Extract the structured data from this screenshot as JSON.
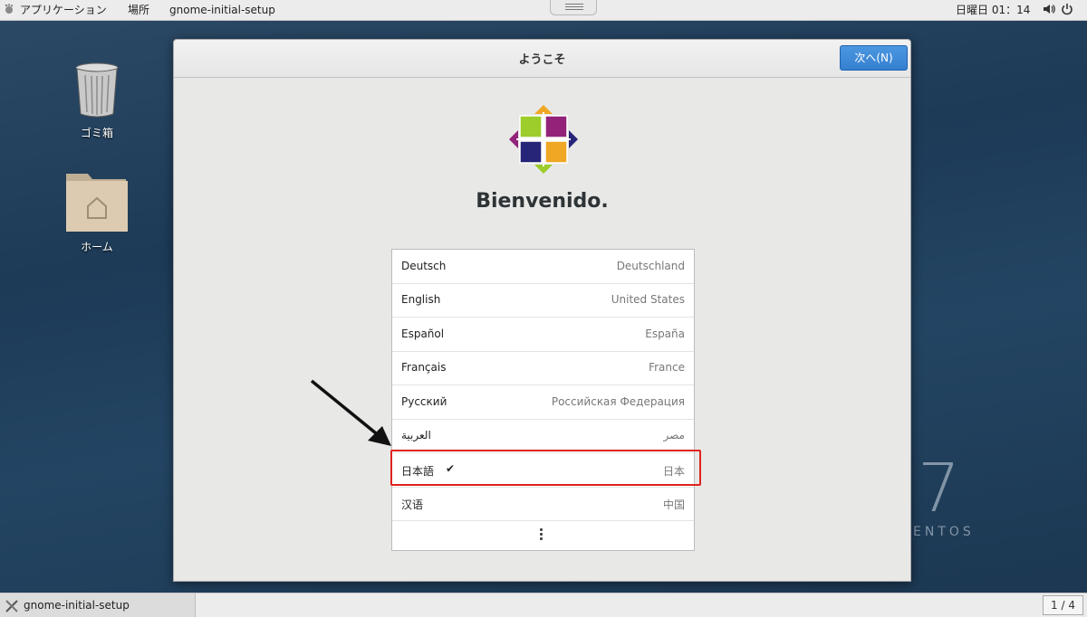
{
  "topbar": {
    "applications_label": "アプリケーション",
    "places_label": "場所",
    "active_app": "gnome-initial-setup",
    "clock": "日曜日 01：14",
    "volume_glyph": "🔊",
    "power_glyph": "⏻"
  },
  "desktop": {
    "trash_label": "ゴミ箱",
    "home_label": "ホーム",
    "watermark_number": "7",
    "watermark_text": "ENTOS"
  },
  "window": {
    "title": "ようこそ",
    "next_button": "次へ(N)",
    "welcome": "Bienvenido.",
    "languages": [
      {
        "name": "Deutsch",
        "region": "Deutschland"
      },
      {
        "name": "English",
        "region": "United States"
      },
      {
        "name": "Español",
        "region": "España"
      },
      {
        "name": "Français",
        "region": "France"
      },
      {
        "name": "Русский",
        "region": "Российская Федерация"
      },
      {
        "name": "العربية",
        "region": "مصر"
      },
      {
        "name": "日本語",
        "region": "日本",
        "selected": true,
        "check": "✔"
      },
      {
        "name": "汉语",
        "region": "中国"
      }
    ]
  },
  "taskbar": {
    "task_label": "gnome-initial-setup",
    "workspace": "1 / 4"
  },
  "colors": {
    "accent": "#3a87d6",
    "highlight": "#e0231c"
  }
}
